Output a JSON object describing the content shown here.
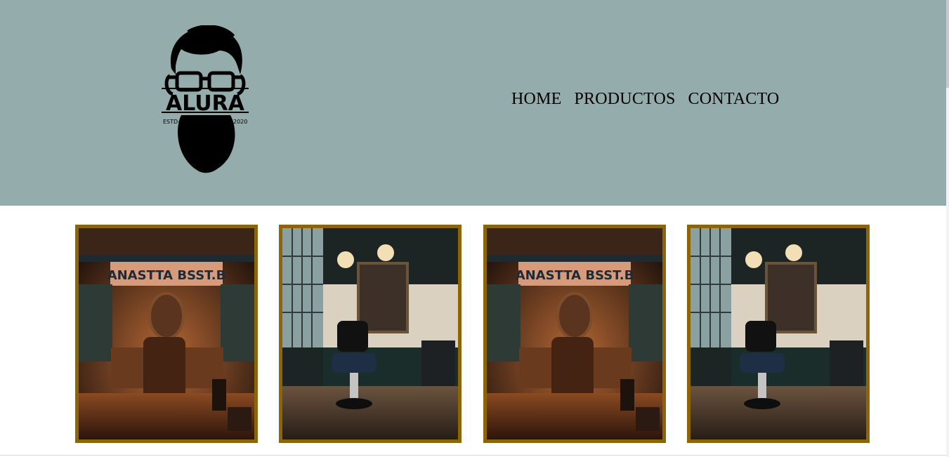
{
  "header": {
    "background": "#95acac",
    "logo": {
      "text": "ALURA",
      "left_text": "ESTD",
      "right_text": "2020",
      "icon": "bearded-man-glasses-logo"
    },
    "nav": [
      {
        "label": "HOME"
      },
      {
        "label": "PRODUCTOS"
      },
      {
        "label": "CONTACTO"
      }
    ]
  },
  "gallery": {
    "border_color": "#8c6508",
    "items": [
      {
        "image": "barbershop-interior-orange",
        "sign_text": "ANASTTA BSST.B"
      },
      {
        "image": "barbershop-interior-blue"
      },
      {
        "image": "barbershop-interior-orange",
        "sign_text": "ANASTTA BSST.B"
      },
      {
        "image": "barbershop-interior-blue"
      }
    ]
  }
}
